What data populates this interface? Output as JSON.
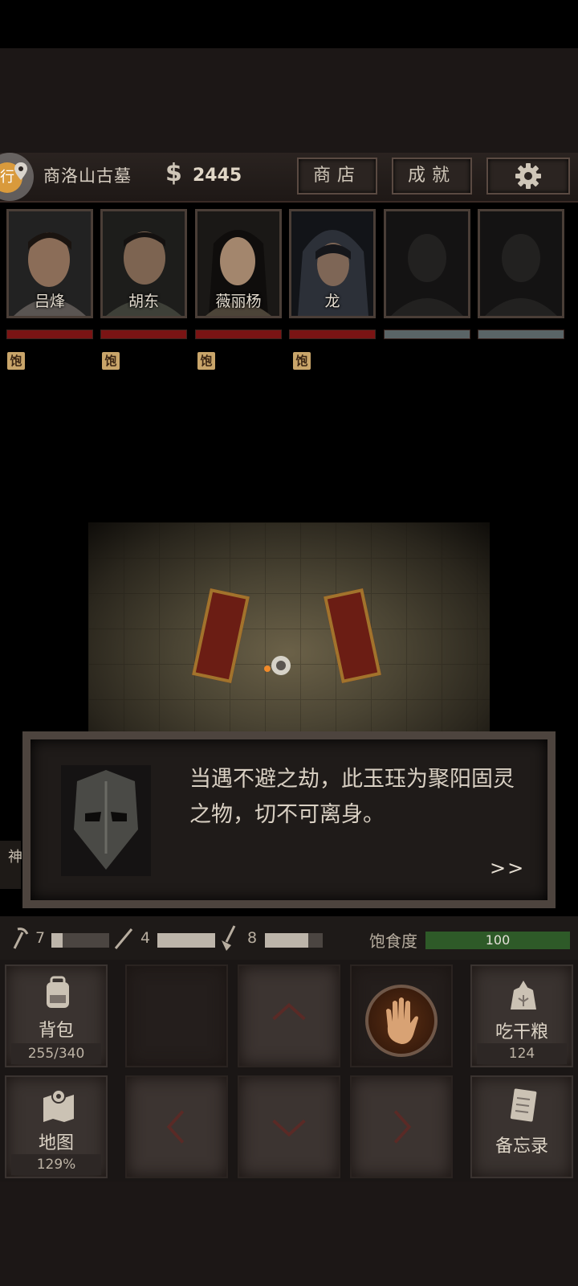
{
  "header": {
    "location_badge": "行",
    "location_name": "商洛山古墓",
    "money_symbol": "$",
    "money": "2445",
    "shop_label": "商店",
    "achievements_label": "成就"
  },
  "party": [
    {
      "name": "吕烽",
      "status": "饱"
    },
    {
      "name": "胡东",
      "status": "饱"
    },
    {
      "name": "薇丽杨",
      "status": "饱"
    },
    {
      "name": "龙",
      "status": "饱"
    }
  ],
  "dialog": {
    "text": "当遇不避之劫，此玉珏为聚阳固灵之物，切不可离身。",
    "next": ">>"
  },
  "side_stub": "神",
  "stats": {
    "tool1_count": "7",
    "tool1_level": 0.2,
    "tool2_count": "4",
    "tool2_level": 1.0,
    "tool3_count": "8",
    "tool3_level": 0.75,
    "satiety_label": "饱食度",
    "satiety_value": "100"
  },
  "controls": {
    "backpack_label": "背包",
    "backpack_value": "255/340",
    "eat_label": "吃干粮",
    "eat_value": "124",
    "map_label": "地图",
    "map_value": "129%",
    "memo_label": "备忘录"
  },
  "colors": {
    "hp_red": "#7a1414",
    "satiety_green": "#2e5a28",
    "coin_gold": "#d99a3c"
  }
}
